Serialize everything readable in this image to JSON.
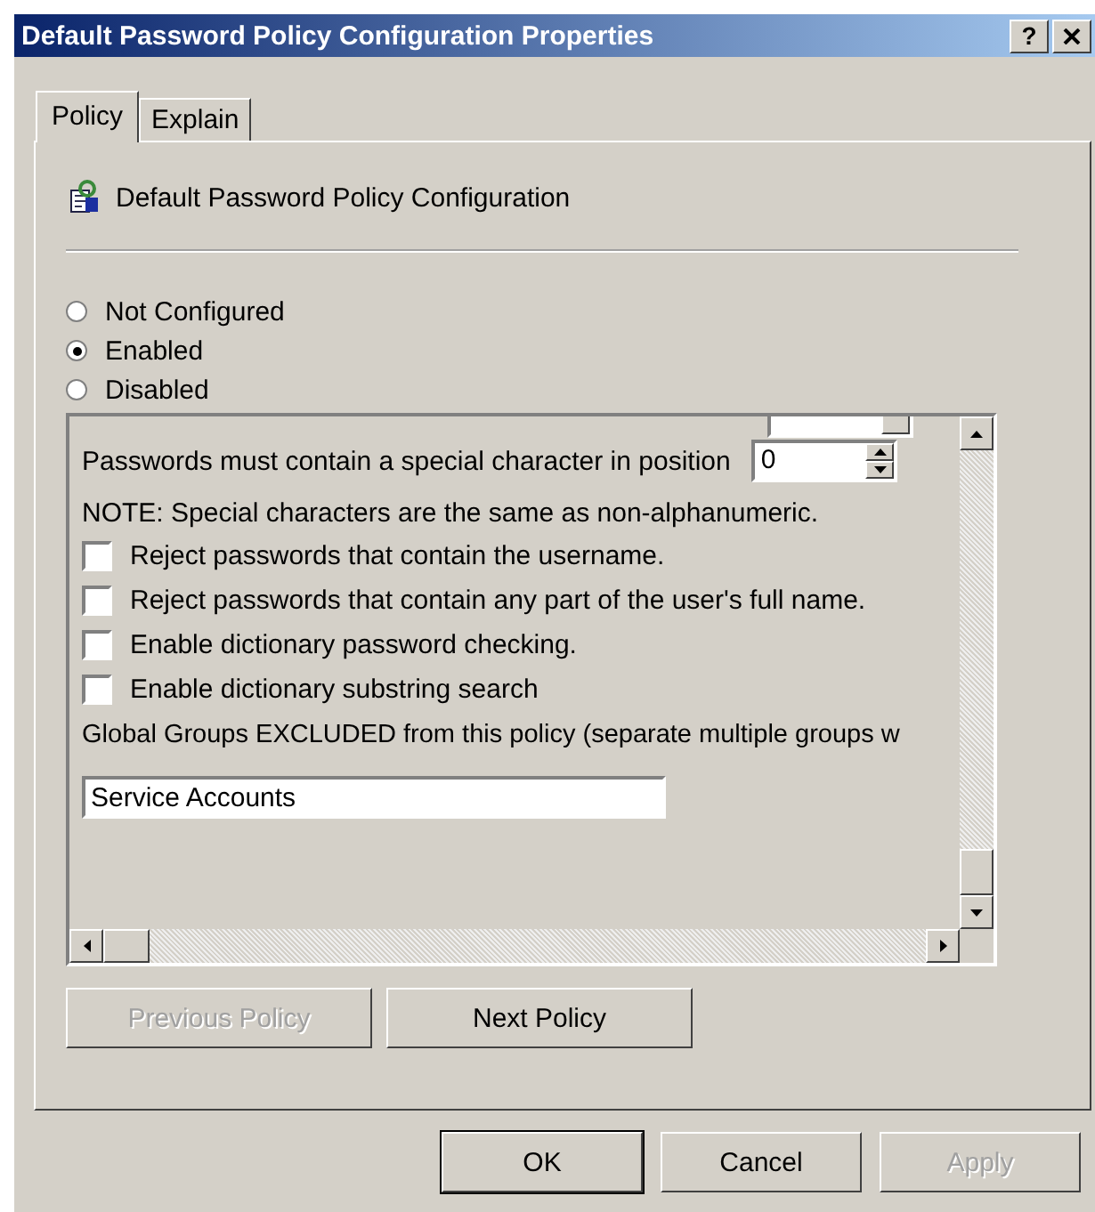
{
  "window": {
    "title": "Default Password Policy Configuration Properties",
    "help_button": "?"
  },
  "tabs": [
    {
      "label": "Policy",
      "selected": true
    },
    {
      "label": "Explain",
      "selected": false
    }
  ],
  "header": {
    "title": "Default Password Policy Configuration"
  },
  "radios": [
    {
      "label": "Not Configured",
      "selected": false
    },
    {
      "label": "Enabled",
      "selected": true
    },
    {
      "label": "Disabled",
      "selected": false
    }
  ],
  "settings": {
    "special_label": "Passwords must contain a special character in position",
    "special_value": "0",
    "note": "NOTE: Special characters are the same as non-alphanumeric.",
    "checkboxes": [
      {
        "label": "Reject passwords that contain the username.",
        "checked": false
      },
      {
        "label": "Reject passwords that contain any part of the user's full name.",
        "checked": false
      },
      {
        "label": "Enable dictionary password checking.",
        "checked": false
      },
      {
        "label": "Enable dictionary substring search",
        "checked": false
      }
    ],
    "groups_label": "Global Groups EXCLUDED from this policy (separate multiple groups w",
    "groups_value": "Service Accounts"
  },
  "nav_buttons": [
    {
      "label": "Previous Policy",
      "disabled": true
    },
    {
      "label": "Next Policy",
      "disabled": false
    }
  ],
  "buttons": [
    {
      "label": "OK",
      "disabled": false,
      "default": true
    },
    {
      "label": "Cancel",
      "disabled": false,
      "default": false
    },
    {
      "label": "Apply",
      "disabled": true,
      "default": false
    }
  ]
}
